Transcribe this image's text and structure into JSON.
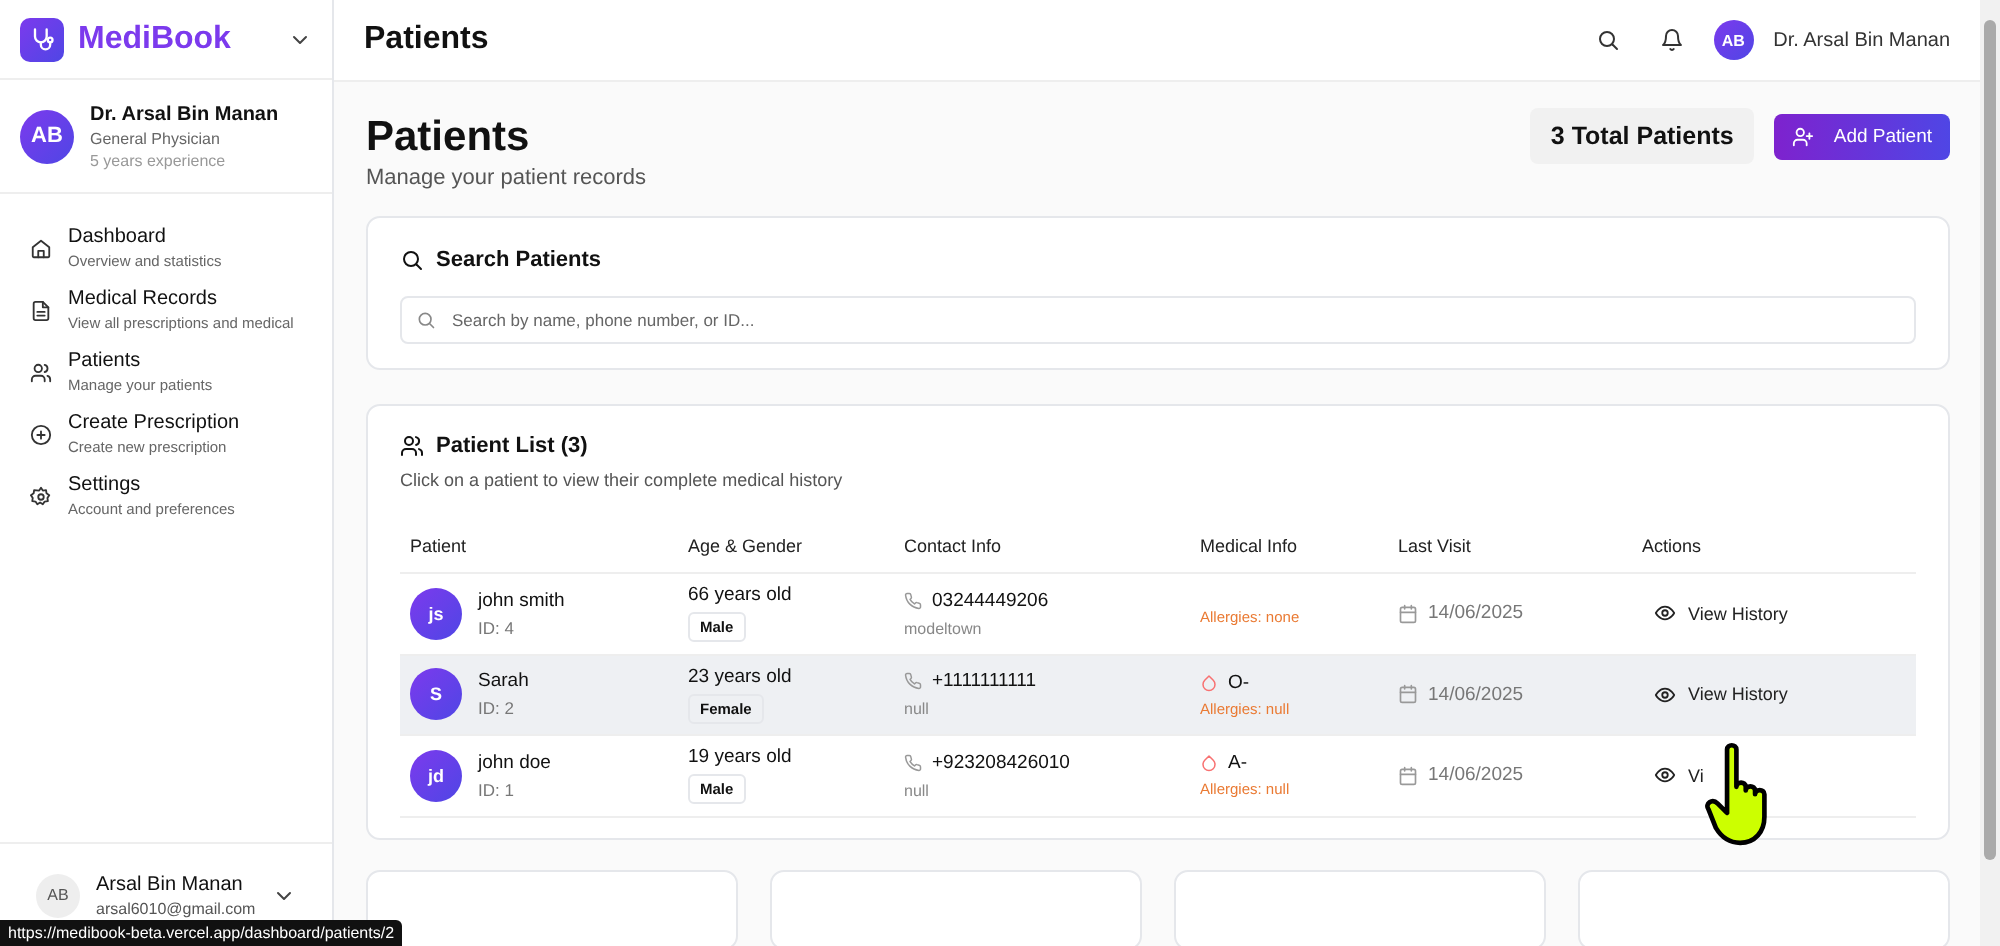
{
  "brand": {
    "name": "MediBook"
  },
  "doctor": {
    "initials": "AB",
    "name": "Dr. Arsal Bin Manan",
    "specialty": "General Physician",
    "experience": "5 years experience"
  },
  "nav": [
    {
      "kind": "home",
      "label": "Dashboard",
      "sub": "Overview and statistics",
      "selected": false
    },
    {
      "kind": "file",
      "label": "Medical Records",
      "sub": "View all prescriptions and medical",
      "selected": false
    },
    {
      "kind": "users",
      "label": "Patients",
      "sub": "Manage your patients",
      "selected": false
    },
    {
      "kind": "plus",
      "label": "Create Prescription",
      "sub": "Create new prescription",
      "selected": false
    },
    {
      "kind": "gear",
      "label": "Settings",
      "sub": "Account and preferences",
      "selected": false
    }
  ],
  "account": {
    "initials": "AB",
    "name": "Arsal Bin Manan",
    "email": "arsal6010@gmail.com"
  },
  "status_url": "https://medibook-beta.vercel.app/dashboard/patients/2",
  "header": {
    "title": "Patients",
    "user_initials": "AB",
    "user_name": "Dr. Arsal Bin Manan"
  },
  "page": {
    "title": "Patients",
    "subtitle": "Manage your patient records",
    "total": "3 Total Patients",
    "add_button": "Add Patient"
  },
  "search": {
    "title": "Search Patients",
    "placeholder": "Search by name, phone number, or ID..."
  },
  "list": {
    "title": "Patient List (3)",
    "hint": "Click on a patient to view their complete medical history",
    "columns": [
      "Patient",
      "Age & Gender",
      "Contact Info",
      "Medical Info",
      "Last Visit",
      "Actions"
    ],
    "rows": [
      {
        "initials": "js",
        "name": "john smith",
        "id": "ID: 4",
        "age": "66 years old",
        "gender": "Male",
        "phone": "03244449206",
        "address": "modeltown",
        "allergies": "Allergies: none",
        "last_visit": "14/06/2025",
        "action": "View History",
        "highlighted": false
      },
      {
        "initials": "S",
        "name": "Sarah",
        "id": "ID: 2",
        "age": "23 years old",
        "gender": "Female",
        "phone": "+1111111111",
        "address": "null",
        "blood_group": "O-",
        "allergies": "Allergies: null",
        "last_visit": "14/06/2025",
        "action": "View History",
        "highlighted": true
      },
      {
        "initials": "jd",
        "name": "john doe",
        "id": "ID: 1",
        "age": "19 years old",
        "gender": "Male",
        "phone": "+923208426010",
        "address": "null",
        "blood_group": "A-",
        "allergies": "Allergies: null",
        "last_visit": "14/06/2025",
        "action": "Vi",
        "highlighted": false
      }
    ]
  },
  "stat_cards": [
    {
      "kind": "card"
    },
    {
      "kind": "card"
    },
    {
      "kind": "card"
    },
    {
      "kind": "card"
    }
  ]
}
